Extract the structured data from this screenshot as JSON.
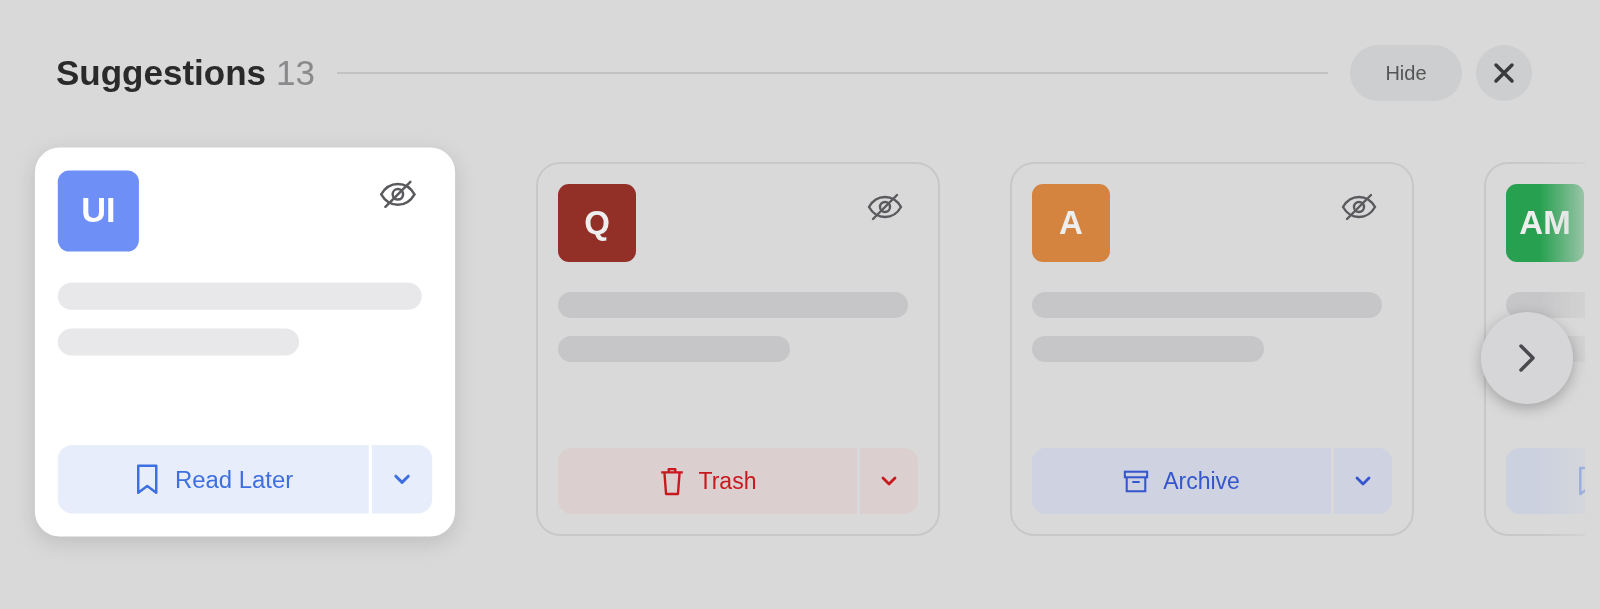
{
  "header": {
    "title": "Suggestions",
    "count": "13",
    "hide_button": "Hide"
  },
  "cards": [
    {
      "avatar": "UI",
      "color": "#6e8ff5",
      "selected": true,
      "action": {
        "kind": "read_later",
        "label": "Read Later"
      }
    },
    {
      "avatar": "Q",
      "color": "#922f26",
      "selected": false,
      "action": {
        "kind": "trash",
        "label": "Trash"
      }
    },
    {
      "avatar": "A",
      "color": "#d4843f",
      "selected": false,
      "action": {
        "kind": "archive",
        "label": "Archive"
      }
    },
    {
      "avatar": "AM",
      "color": "#27a050",
      "selected": false,
      "partial": true,
      "action": {
        "kind": "read_later"
      }
    }
  ]
}
